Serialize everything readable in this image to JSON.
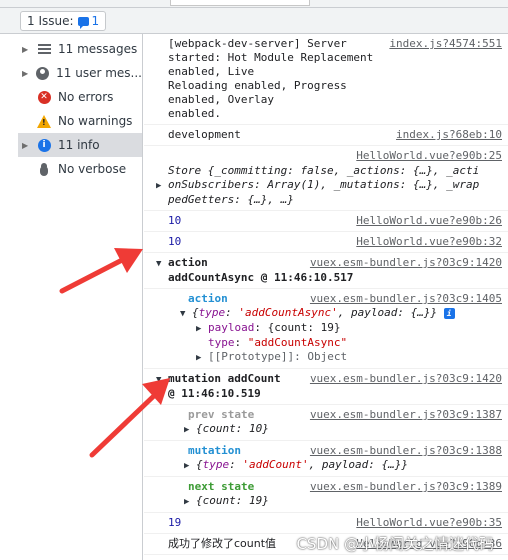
{
  "toolbar": {
    "issue_label": "1 Issue:",
    "issue_count": "1"
  },
  "sidebar": {
    "items": [
      {
        "label": "11 messages",
        "icon": "list-icon",
        "expandable": true
      },
      {
        "label": "11 user mes...",
        "icon": "user-icon",
        "expandable": true
      },
      {
        "label": "No errors",
        "icon": "error-icon",
        "expandable": false
      },
      {
        "label": "No warnings",
        "icon": "warning-icon",
        "expandable": false
      },
      {
        "label": "11 info",
        "icon": "info-icon",
        "expandable": true,
        "selected": true
      },
      {
        "label": "No verbose",
        "icon": "bug-icon",
        "expandable": false
      }
    ]
  },
  "console": {
    "rows": [
      {
        "text": "[webpack-dev-server] Server\nstarted: Hot Module Replacement enabled, Live\nReloading enabled, Progress enabled, Overlay\nenabled.",
        "source": "index.js?4574:551"
      },
      {
        "text": "development",
        "source": "index.js?68eb:10"
      },
      {
        "source": "HelloWorld.vue?e90b:25",
        "store_line1": "Store {_committing: false, _actions: {…}, _acti",
        "store_line2": "onSubscribers: Array(1), _mutations: {…}, _wrap",
        "store_line3": "pedGetters: {…}, …}"
      },
      {
        "text": "10",
        "source": "HelloWorld.vue?e90b:26"
      },
      {
        "text": "10",
        "source": "HelloWorld.vue?e90b:32"
      }
    ],
    "action_group": {
      "title": "action",
      "subtitle": "addCountAsync @ 11:46:10.517",
      "source": "vuex.esm-bundler.js?03c9:1420",
      "action_label": "action",
      "action_source": "vuex.esm-bundler.js?03c9:1405",
      "action_obj_type_key": "type",
      "action_obj_type_val": "'addCountAsync'",
      "action_obj_payload": "payload: {…}",
      "payload_key": "payload",
      "payload_val": "{count: 19}",
      "type_key": "type",
      "type_val": "\"addCountAsync\"",
      "prototype": "[[Prototype]]: Object"
    },
    "mutation_group": {
      "title": "mutation addCount",
      "subtitle": "@ 11:46:10.519",
      "source": "vuex.esm-bundler.js?03c9:1420",
      "prev_label": "prev state",
      "prev_source": "vuex.esm-bundler.js?03c9:1387",
      "prev_obj": "{count: 10}",
      "mutation_label": "mutation",
      "mutation_source": "vuex.esm-bundler.js?03c9:1388",
      "mutation_obj_type_val": "'addCount'",
      "mutation_obj_payload": "payload: {…}",
      "next_label": "next state",
      "next_source": "vuex.esm-bundler.js?03c9:1389",
      "next_obj": "{count: 19}"
    },
    "tail_rows": [
      {
        "text": "19",
        "source": "HelloWorld.vue?e90b:35"
      },
      {
        "text": "成功了修改了count值",
        "source": "HelloWorld.vue?e90b:36"
      }
    ],
    "prompt_symbol": "›"
  },
  "watermark": "CSDN @小杨闯关之情迷代码",
  "colors": {
    "accent_blue": "#1a73e8",
    "error_red": "#d93025",
    "warning_yellow": "#f2a600",
    "annotation_arrow": "#ef3b36"
  }
}
